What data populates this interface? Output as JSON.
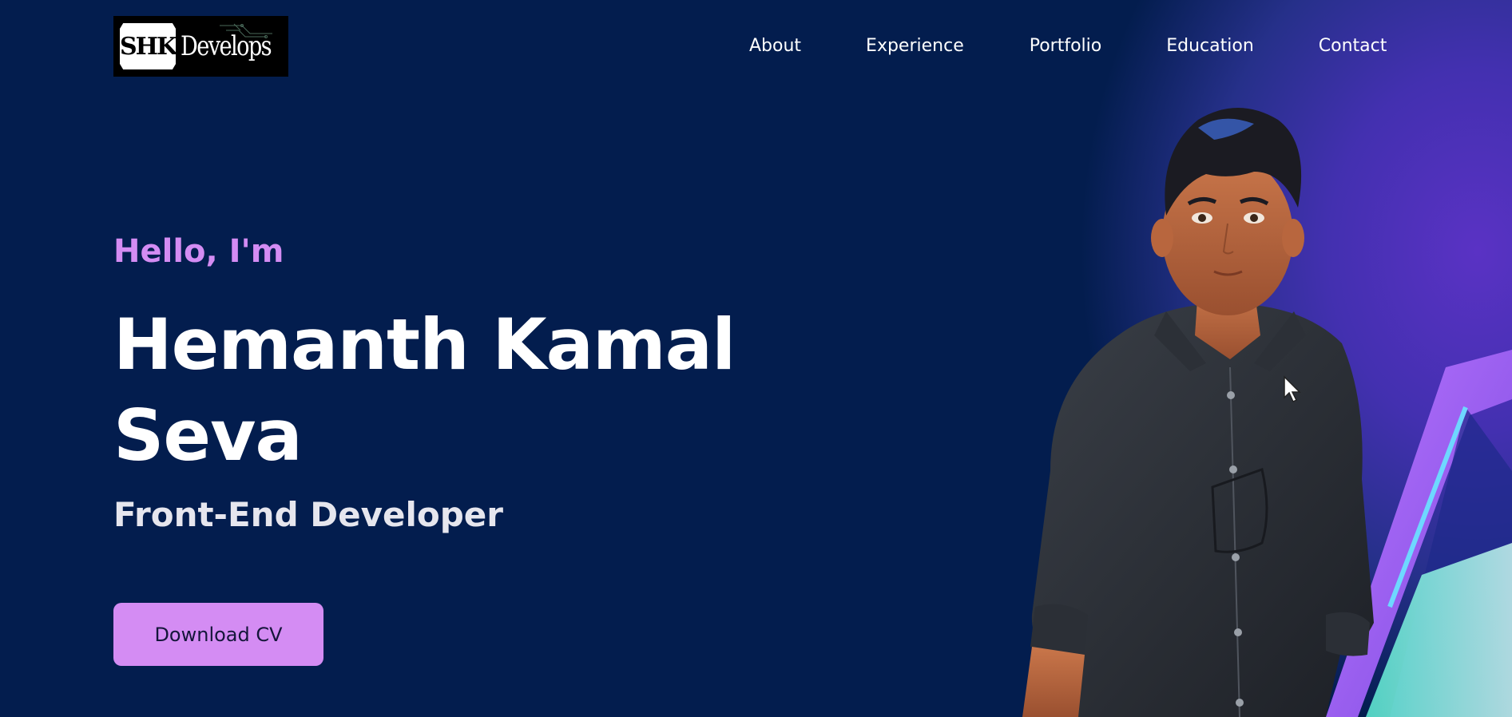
{
  "header": {
    "logo": {
      "box_text": "SHK",
      "text": "Develops"
    },
    "nav": [
      {
        "label": "About"
      },
      {
        "label": "Experience"
      },
      {
        "label": "Portfolio"
      },
      {
        "label": "Education"
      },
      {
        "label": "Contact"
      }
    ]
  },
  "hero": {
    "greeting": "Hello, I'm",
    "name": "Hemanth Kamal Seva",
    "role": "Front-End Developer",
    "cta_label": "Download CV",
    "avatar_icon": "3d-avatar-illustration"
  },
  "colors": {
    "background": "#031d4e",
    "accent": "#d48cf3",
    "text": "#ffffff"
  }
}
